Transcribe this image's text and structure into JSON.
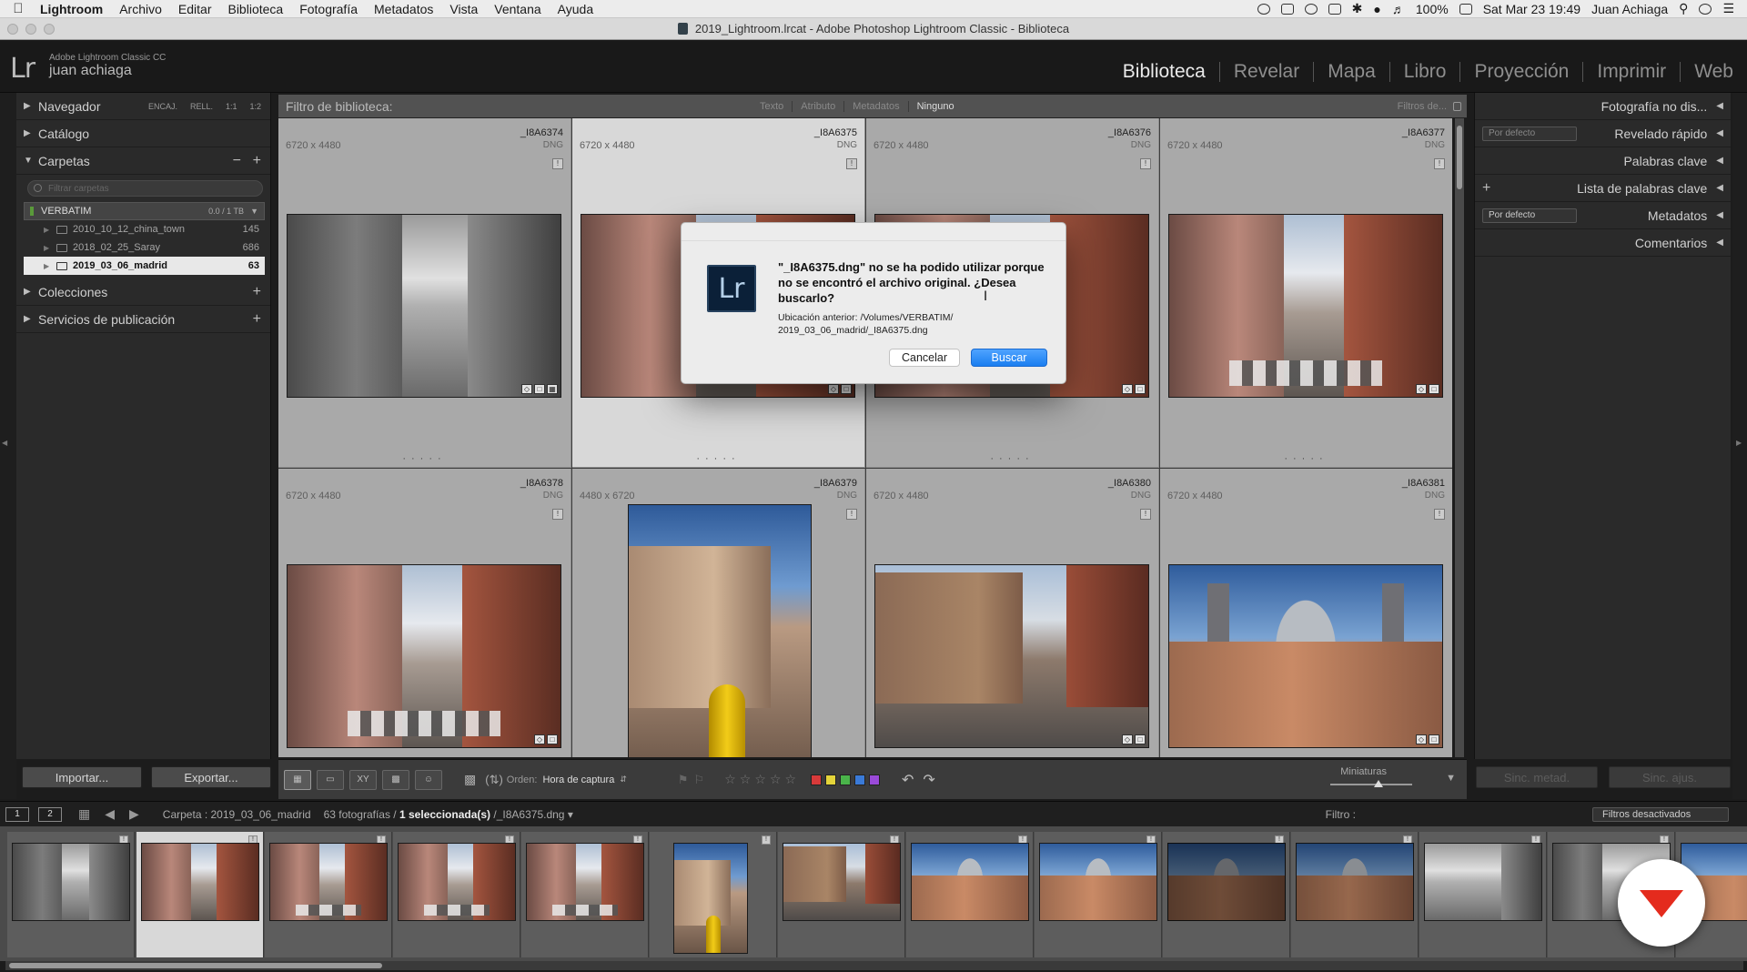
{
  "menubar": {
    "app": "Lightroom",
    "items": [
      "Archivo",
      "Editar",
      "Biblioteca",
      "Fotografía",
      "Metadatos",
      "Vista",
      "Ventana",
      "Ayuda"
    ],
    "battery": "100%",
    "clock": "Sat Mar 23  19:49",
    "user": "Juan Achiaga"
  },
  "window": {
    "title": "2019_Lightroom.lrcat - Adobe Photoshop Lightroom Classic - Biblioteca"
  },
  "identity": {
    "logo": "Lr",
    "product": "Adobe Lightroom Classic CC",
    "user": "juan achiaga"
  },
  "modules": [
    "Biblioteca",
    "Revelar",
    "Mapa",
    "Libro",
    "Proyección",
    "Imprimir",
    "Web"
  ],
  "left_panel": {
    "navigator": "Navegador",
    "nav_zoom": [
      "ENCAJ.",
      "RELL.",
      "1:1",
      "1:2"
    ],
    "catalog": "Catálogo",
    "folders": "Carpetas",
    "folder_search_placeholder": "Filtrar carpetas",
    "volume": {
      "name": "VERBATIM",
      "capacity": "0.0 / 1 TB"
    },
    "folder_list": [
      {
        "name": "2010_10_12_china_town",
        "count": "145"
      },
      {
        "name": "2018_02_25_Saray",
        "count": "686"
      },
      {
        "name": "2019_03_06_madrid",
        "count": "63"
      }
    ],
    "collections": "Colecciones",
    "publish": "Servicios de publicación",
    "import_button": "Importar...",
    "export_button": "Exportar..."
  },
  "filter_bar": {
    "label": "Filtro de biblioteca:",
    "modes": [
      "Texto",
      "Atributo",
      "Metadatos",
      "Ninguno"
    ],
    "preset": "Filtros de..."
  },
  "grid": [
    {
      "name": "_I8A6374",
      "type": "DNG",
      "dims": "6720 x 4480"
    },
    {
      "name": "_I8A6375",
      "type": "DNG",
      "dims": "6720 x 4480"
    },
    {
      "name": "_I8A6376",
      "type": "DNG",
      "dims": "6720 x 4480"
    },
    {
      "name": "_I8A6377",
      "type": "DNG",
      "dims": "6720 x 4480"
    },
    {
      "name": "_I8A6378",
      "type": "DNG",
      "dims": "6720 x 4480"
    },
    {
      "name": "_I8A6379",
      "type": "DNG",
      "dims": "4480 x 6720"
    },
    {
      "name": "_I8A6380",
      "type": "DNG",
      "dims": "6720 x 4480"
    },
    {
      "name": "_I8A6381",
      "type": "DNG",
      "dims": "6720 x 4480"
    }
  ],
  "dialog": {
    "logo": "Lr",
    "message": "\"_I8A6375.dng\" no se ha podido utilizar porque no se encontró el archivo original. ¿Desea buscarlo?",
    "info": "Ubicación anterior: /Volumes/VERBATIM/ 2019_03_06_madrid/_I8A6375.dng",
    "cancel": "Cancelar",
    "find": "Buscar"
  },
  "toolbar": {
    "sort_label": "Orden:",
    "sort_value": "Hora de captura",
    "thumbnails_label": "Miniaturas",
    "rating": 0,
    "label_colors": [
      "#d83a3a",
      "#e4d43a",
      "#4ab44a",
      "#3a7ad8",
      "#9a4ad8"
    ]
  },
  "right_panel": {
    "histogram": "Fotografía no dis...",
    "quick_develop": "Revelado rápido",
    "quick_develop_preset": "Por defecto",
    "keywording": "Palabras clave",
    "keyword_list": "Lista de palabras clave",
    "metadata": "Metadatos",
    "metadata_preset": "Por defecto",
    "comments": "Comentarios",
    "sync_meta": "Sinc. metad.",
    "sync_settings": "Sinc. ajus."
  },
  "filmstrip": {
    "screens": [
      "1",
      "2"
    ],
    "source": "Carpeta : 2019_03_06_madrid",
    "count_prefix": "63 fotografías /",
    "selected": "1 seleccionada(s)",
    "file": "/_I8A6375.dng",
    "filter_label": "Filtro :",
    "filter_value": "Filtros desactivados"
  }
}
